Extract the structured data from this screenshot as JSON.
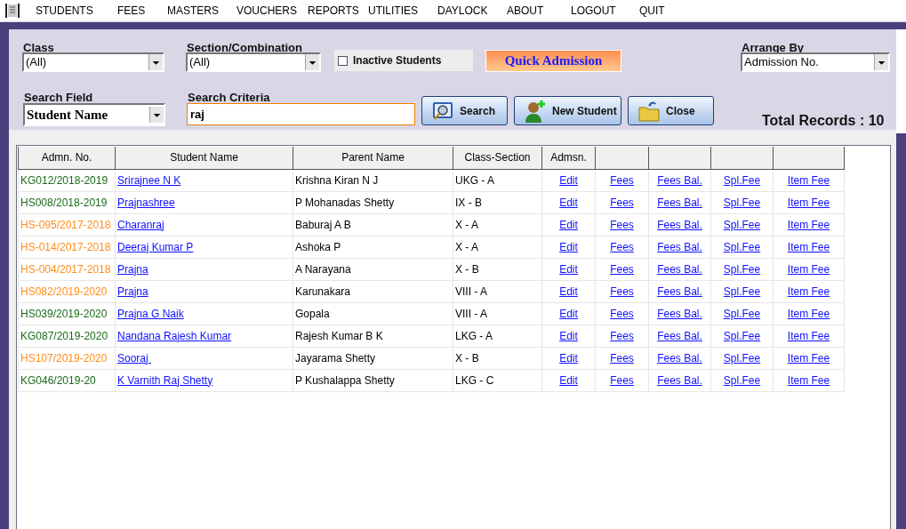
{
  "menu": [
    "STUDENTS",
    "FEES",
    "MASTERS",
    "VOUCHERS",
    "REPORTS",
    "UTILITIES",
    "DAYLOCK",
    "ABOUT",
    "LOGOUT",
    "QUIT"
  ],
  "filters": {
    "class": {
      "label": "Class",
      "value": "(All)"
    },
    "section": {
      "label": "Section/Combination",
      "value": "(All)"
    },
    "inactive": {
      "label": "Inactive Students",
      "checked": false
    },
    "quick_admission": "Quick Admission",
    "arrange_by": {
      "label": "Arrange By",
      "value": "Admission No."
    },
    "search_field": {
      "label": "Search Field",
      "value": "Student Name"
    },
    "search_criteria": {
      "label": "Search Criteria",
      "value": "raj"
    }
  },
  "buttons": [
    {
      "kind": "search",
      "label": "Search"
    },
    {
      "kind": "new",
      "label": "New Student"
    },
    {
      "kind": "close",
      "label": "Close"
    }
  ],
  "total_records": "Total Records : 10",
  "table": {
    "columns": [
      "Admn. No.",
      "Student Name",
      "Parent Name",
      "Class-Section",
      "Admsn."
    ],
    "rows": [
      {
        "admn_no": "KG012/2018-2019",
        "color": "#1a6b1a",
        "student": "Srirajnee N K",
        "parent": "Krishna Kiran N J",
        "class_section": "UKG - A",
        "links": [
          "Edit",
          "Fees",
          "Fees Bal.",
          "Spl.Fee",
          "Item Fee"
        ]
      },
      {
        "admn_no": "HS008/2018-2019",
        "color": "#1a6b1a",
        "student": "Prajnashree",
        "parent": "P Mohanadas Shetty",
        "class_section": "IX - B",
        "links": [
          "Edit",
          "Fees",
          "Fees Bal.",
          "Spl.Fee",
          "Item Fee"
        ]
      },
      {
        "admn_no": "HS-095/2017-2018",
        "color": "#ff8c1a",
        "student": "Charanraj",
        "parent": "Baburaj A B",
        "class_section": "X - A",
        "links": [
          "Edit",
          "Fees",
          "Fees Bal.",
          "Spl.Fee",
          "Item Fee"
        ]
      },
      {
        "admn_no": "HS-014/2017-2018",
        "color": "#ff8c1a",
        "student": "Deeraj Kumar P",
        "parent": "Ashoka P",
        "class_section": "X - A",
        "links": [
          "Edit",
          "Fees",
          "Fees Bal.",
          "Spl.Fee",
          "Item Fee"
        ]
      },
      {
        "admn_no": "HS-004/2017-2018",
        "color": "#ff8c1a",
        "student": "Prajna",
        "parent": "A Narayana",
        "class_section": "X - B",
        "links": [
          "Edit",
          "Fees",
          "Fees Bal.",
          "Spl.Fee",
          "Item Fee"
        ]
      },
      {
        "admn_no": "HS082/2019-2020",
        "color": "#ff8c1a",
        "student": "Prajna",
        "parent": "Karunakara",
        "class_section": "VIII - A",
        "links": [
          "Edit",
          "Fees",
          "Fees Bal.",
          "Spl.Fee",
          "Item Fee"
        ]
      },
      {
        "admn_no": "HS039/2019-2020",
        "color": "#1a6b1a",
        "student": "Prajna G Naik",
        "parent": "Gopala",
        "class_section": "VIII - A",
        "links": [
          "Edit",
          "Fees",
          "Fees Bal.",
          "Spl.Fee",
          "Item Fee"
        ]
      },
      {
        "admn_no": "KG087/2019-2020",
        "color": "#1a6b1a",
        "student": "Nandana Rajesh Kumar",
        "parent": "Rajesh Kumar B K",
        "class_section": "LKG - A",
        "links": [
          "Edit",
          "Fees",
          "Fees Bal.",
          "Spl.Fee",
          "Item Fee"
        ]
      },
      {
        "admn_no": "HS107/2019-2020",
        "color": "#ff8c1a",
        "student": "Sooraj ",
        "parent": "Jayarama Shetty",
        "class_section": "X - B",
        "links": [
          "Edit",
          "Fees",
          "Fees Bal.",
          "Spl.Fee",
          "Item Fee"
        ]
      },
      {
        "admn_no": "KG046/2019-20",
        "color": "#1a6b1a",
        "student": "K Varnith Raj Shetty",
        "parent": "P Kushalappa Shetty",
        "class_section": "LKG - C",
        "links": [
          "Edit",
          "Fees",
          "Fees Bal.",
          "Spl.Fee",
          "Item Fee"
        ]
      }
    ]
  }
}
